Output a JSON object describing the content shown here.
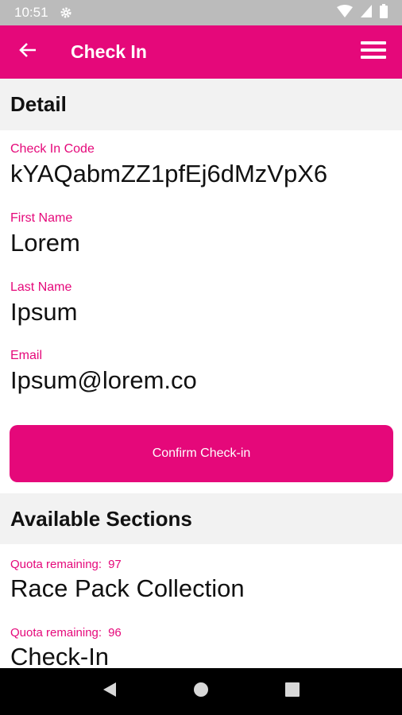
{
  "status_bar": {
    "time": "10:51",
    "icons": [
      "gear-icon",
      "wifi-icon",
      "signal-icon",
      "battery-icon"
    ]
  },
  "app_bar": {
    "title": "Check In",
    "back_icon": "arrow-left-icon",
    "menu_icon": "hamburger-menu-icon",
    "color": "#e5087a"
  },
  "detail": {
    "header": "Detail",
    "fields": [
      {
        "label": "Check In Code",
        "value": "kYAQabmZZ1pfEj6dMzVpX6"
      },
      {
        "label": "First Name",
        "value": "Lorem"
      },
      {
        "label": "Last Name",
        "value": "Ipsum"
      },
      {
        "label": "Email",
        "value": "Ipsum@lorem.co"
      }
    ],
    "confirm_label": "Confirm Check-in"
  },
  "sections": {
    "header": "Available Sections",
    "quota_label": "Quota remaining:",
    "items": [
      {
        "quota": "97",
        "name": "Race Pack Collection"
      },
      {
        "quota": "96",
        "name": "Check-In"
      }
    ]
  },
  "nav_bar": {
    "icons": [
      "back-triangle-icon",
      "home-circle-icon",
      "recents-square-icon"
    ]
  },
  "colors": {
    "accent": "#e5087a",
    "section_bg": "#f2f2f2",
    "status_bar": "#bbbbbb"
  }
}
